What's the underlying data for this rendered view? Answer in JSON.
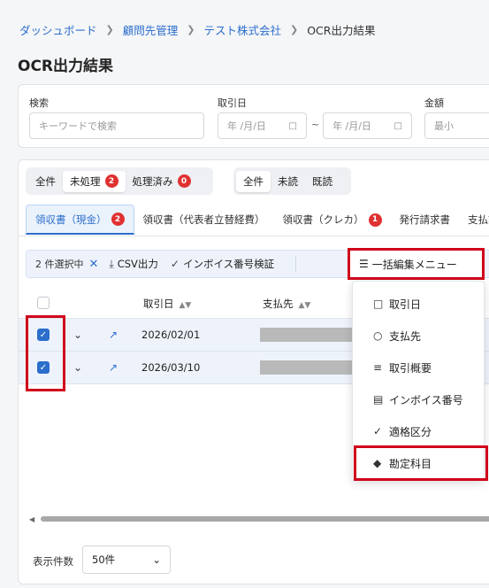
{
  "breadcrumb": {
    "items": [
      "ダッシュボード",
      "顧問先管理",
      "テスト株式会社"
    ],
    "current": "OCR出力結果"
  },
  "page_title": "OCR出力結果",
  "filters": {
    "search": {
      "label": "検索",
      "placeholder": "キーワードで検索"
    },
    "date": {
      "label": "取引日",
      "from": "年 /月/日",
      "to": "年 /月/日",
      "separator": "~"
    },
    "amount": {
      "label": "金額",
      "placeholder": "最小"
    }
  },
  "status_segment": [
    {
      "label": "全件",
      "active": false
    },
    {
      "label": "未処理",
      "badge": "2",
      "active": true
    },
    {
      "label": "処理済み",
      "badge": "0",
      "active": false
    }
  ],
  "read_segment": [
    {
      "label": "全件",
      "active": true
    },
    {
      "label": "未読",
      "active": false
    },
    {
      "label": "既読",
      "active": false
    }
  ],
  "tabs": [
    {
      "label": "領収書（現金）",
      "badge": "2",
      "active": true
    },
    {
      "label": "領収書（代表者立替経費）"
    },
    {
      "label": "領収書（クレカ）",
      "badge": "1"
    },
    {
      "label": "発行請求書"
    },
    {
      "label": "支払請"
    }
  ],
  "action_bar": {
    "selected": "2 件選択中",
    "csv": "CSV出力",
    "invoice_check": "インボイス番号検証",
    "bulk_menu": "一括編集メニュー"
  },
  "table": {
    "columns": {
      "date": "取引日",
      "payee": "支払先"
    },
    "rows": [
      {
        "date": "2026/02/01",
        "checked": true
      },
      {
        "date": "2026/03/10",
        "checked": true
      }
    ]
  },
  "bulk_menu_items": [
    {
      "label": "取引日",
      "icon": "calendar-icon"
    },
    {
      "label": "支払先",
      "icon": "person-icon"
    },
    {
      "label": "取引概要",
      "icon": "document-icon"
    },
    {
      "label": "インボイス番号",
      "icon": "id-card-icon"
    },
    {
      "label": "適格区分",
      "icon": "check-circle-icon"
    },
    {
      "label": "勘定科目",
      "icon": "tag-icon"
    }
  ],
  "pagination": {
    "per_page_label": "表示件数",
    "per_page_value": "50件"
  },
  "colors": {
    "accent": "#2c6ecb",
    "badge": "#e03131",
    "highlight": "#d0021b"
  }
}
